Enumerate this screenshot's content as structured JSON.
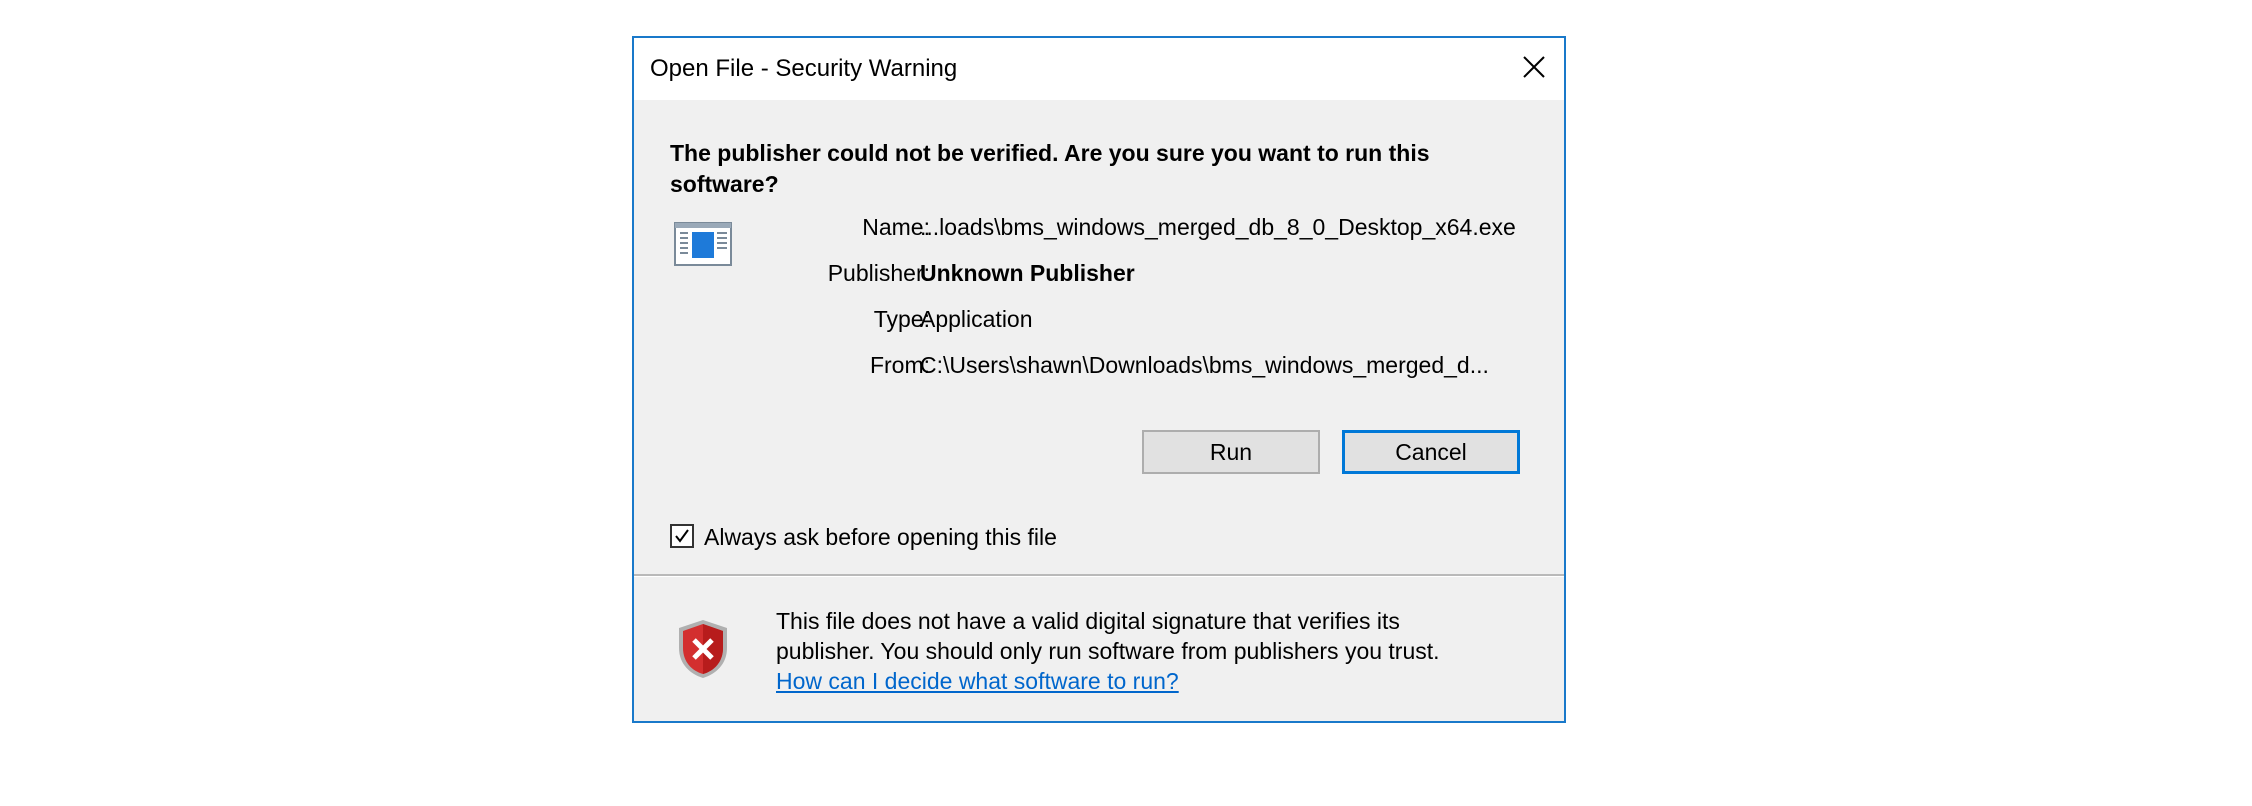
{
  "dialog": {
    "title": "Open File - Security Warning",
    "close_icon": "close-icon",
    "headline": "The publisher could not be verified.  Are you sure you want to run this software?",
    "file_icon": "application-window-icon",
    "info": [
      {
        "label": "Name:",
        "value": "...loads\\bms_windows_merged_db_8_0_Desktop_x64.exe",
        "bold": false
      },
      {
        "label": "Publisher:",
        "value": "Unknown Publisher",
        "bold": true
      },
      {
        "label": "Type:",
        "value": "Application",
        "bold": false
      },
      {
        "label": "From:",
        "value": "C:\\Users\\shawn\\Downloads\\bms_windows_merged_d...",
        "bold": false
      }
    ],
    "buttons": {
      "run_label": "Run",
      "cancel_label": "Cancel"
    },
    "checkbox": {
      "label": "Always ask before opening this file",
      "checked": true
    },
    "warning": {
      "icon": "shield-error-icon",
      "line1": "This file does not have a valid digital signature that verifies its",
      "line2": "publisher.  You should only run software from publishers you trust.",
      "link_text": "How can I decide what software to run?"
    },
    "colors": {
      "accent": "#0078d7",
      "border": "#1979ca",
      "link": "#0066cc",
      "shield_red": "#d32f2f"
    }
  }
}
